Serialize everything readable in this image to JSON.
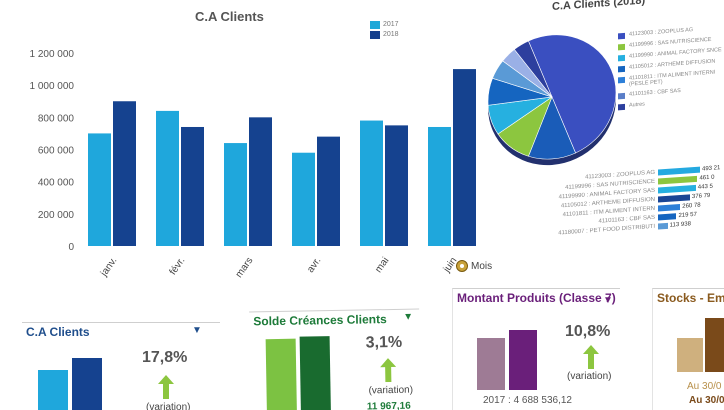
{
  "main_chart": {
    "title": "C.A Clients",
    "legend": [
      {
        "name": "2017",
        "color": "#20a8d8"
      },
      {
        "name": "2018",
        "color": "#143f8c"
      }
    ],
    "mois_label": "Mois"
  },
  "chart_data": [
    {
      "type": "bar",
      "title": "C.A Clients",
      "categories": [
        "janv.",
        "févr.",
        "mars",
        "avr.",
        "mai",
        "juin"
      ],
      "series": [
        {
          "name": "2017",
          "values": [
            700000,
            840000,
            640000,
            580000,
            780000,
            740000
          ]
        },
        {
          "name": "2018",
          "values": [
            900000,
            740000,
            800000,
            680000,
            750000,
            1100000
          ]
        }
      ],
      "ylim": [
        0,
        1200000
      ],
      "yticks": [
        "0",
        "200 000",
        "400 000",
        "600 000",
        "800 000",
        "1 000 000",
        "1 200 000"
      ],
      "colors": [
        "#1fa7dc",
        "#15428f"
      ],
      "grid": false,
      "legend": "top-right"
    },
    {
      "type": "pie",
      "title": "C.A Clients  (2018)",
      "colors": [
        "#3a4fc0",
        "#1a5cb8",
        "#8cc63f",
        "#26b0e0",
        "#1565c0",
        "#5a9ad6",
        "#9ab0e6",
        "#2d3f9e"
      ],
      "labels": [
        "41123003 : ZOOPLUS AG",
        "41199996 : SAS NUTRISCIENCE",
        "41199990 : ANIMAL FACTORY SNCE",
        "41105012 : ARTHEME DIFFUSION",
        "41101811 : ITM ALIMENT INTERNI (PESLE PET)",
        "41101163 : CBF SAS",
        "",
        "Autres"
      ],
      "values": [
        50,
        12,
        10,
        8,
        7,
        5,
        4,
        4
      ]
    },
    {
      "type": "bar",
      "orientation": "horizontal",
      "categories": [
        "41123003 : ZOOPLUS AG",
        "41199996 : SAS NUTRISCIENCE",
        "41199990 : ANIMAL FACTORY SAS",
        "41105012 : ARTHEME DIFFUSION",
        "41101811 : ITM ALIMENT INTERN",
        "41101163 : CBF SAS",
        "41180007 : PET FOOD DISTRIBUTI"
      ],
      "values": [
        493,
        461,
        443,
        376,
        260,
        219,
        113
      ],
      "value_labels": [
        "493 21",
        "461 0",
        "443 5",
        "376 79",
        "260 78",
        "219 57",
        "113 938"
      ]
    }
  ],
  "pie": {
    "title": "C.A Clients  (2018)",
    "legend": [
      {
        "label": "41123003 : ZOOPLUS AG",
        "color": "#3a4fc0"
      },
      {
        "label": "41199996 : SAS NUTRISCIENCE",
        "color": "#8cc63f"
      },
      {
        "label": "41199990 : ANIMAL FACTORY SNCE",
        "color": "#26b0e0"
      },
      {
        "label": "41105012 : ARTHEME DIFFUSION",
        "color": "#1565c0"
      },
      {
        "label": "41101811 : ITM ALIMENT INTERNI (PESLE PET)",
        "color": "#2d7fd8"
      },
      {
        "label": "41101163 : CBF SAS",
        "color": "#5a7ec8"
      },
      {
        "label": "Autres",
        "color": "#2d3f9e"
      }
    ]
  },
  "hbars": {
    "rows": [
      {
        "label": "41123003 : ZOOPLUS AG",
        "value": "493 21",
        "color": "#24a9e0",
        "pct": 100
      },
      {
        "label": "41199996 : SAS NUTRISCIENCE",
        "value": "461 0",
        "color": "#8cc63f",
        "pct": 94
      },
      {
        "label": "41199990 : ANIMAL FACTORY SAS",
        "value": "443 5",
        "color": "#26b0e0",
        "pct": 90
      },
      {
        "label": "41105012 : ARTHEME DIFFUSION",
        "value": "376 79",
        "color": "#1a4595",
        "pct": 76
      },
      {
        "label": "41101811 : ITM ALIMENT INTERN",
        "value": "260 78",
        "color": "#2d7fd8",
        "pct": 53
      },
      {
        "label": "41101163 : CBF SAS",
        "value": "219 57",
        "color": "#1565c0",
        "pct": 44
      },
      {
        "label": "41180007 : PET FOOD DISTRIBUTI",
        "value": "113 938",
        "color": "#5a9ad6",
        "pct": 23
      }
    ]
  },
  "cards": {
    "ca_clients": {
      "title": "C.A Clients",
      "title_color": "#1f4e8c",
      "pct": "17,8%",
      "variation": "(variation)",
      "colors": [
        "#1fa7dc",
        "#15428f"
      ],
      "levels": [
        0.45,
        0.6
      ]
    },
    "solde": {
      "title": "Solde Créances Clients",
      "title_color": "#1e7b3a",
      "pct": "3,1%",
      "variation": "(variation)",
      "foot": "11 967,16",
      "colors": [
        "#7cc242",
        "#196b2f"
      ],
      "levels": [
        0.8,
        0.82
      ]
    },
    "montant": {
      "title": "Montant Produits (Classe 7)",
      "title_color": "#6a1f7a",
      "pct": "10,8%",
      "variation": "(variation)",
      "foot": "2017 : 4 688 536,12",
      "colors": [
        "#9e7b95",
        "#6a1f7a"
      ],
      "levels": [
        0.55,
        0.63
      ]
    },
    "stocks": {
      "title": "Stocks - Emb",
      "title_color": "#8a5a1e",
      "foot1": "Au 30/0",
      "foot2": "Au 30/0",
      "colors": [
        "#cfb07e",
        "#7a4a1a"
      ],
      "levels": [
        0.4,
        0.6
      ]
    }
  }
}
